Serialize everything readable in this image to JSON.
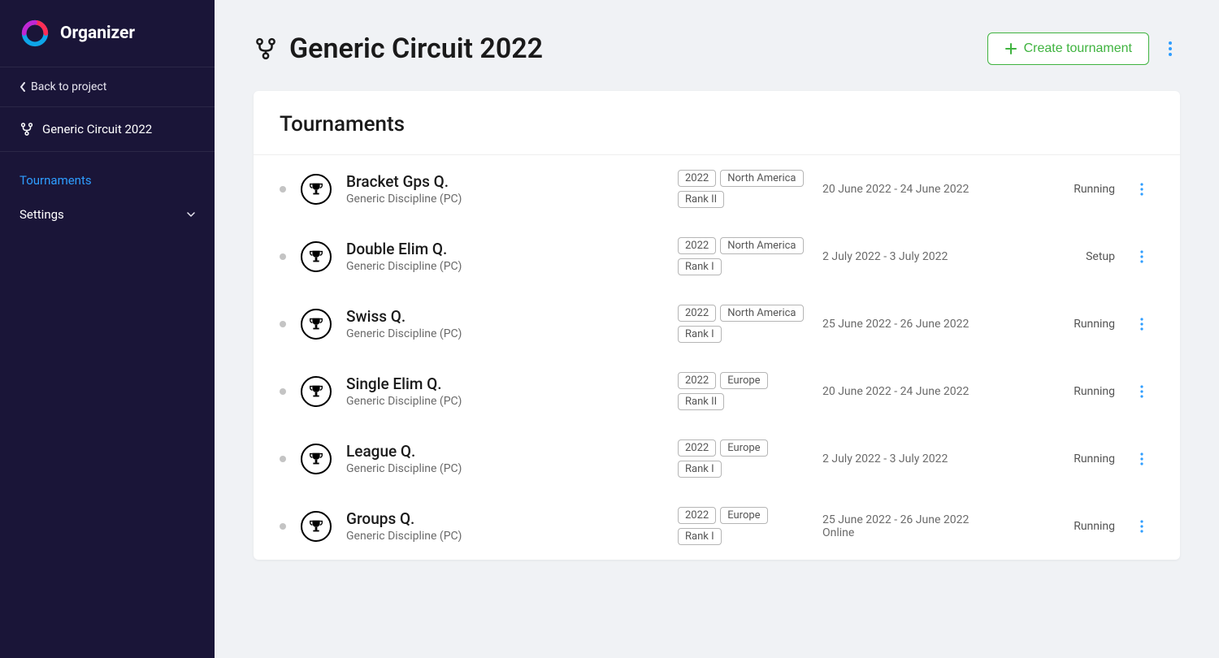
{
  "brand": {
    "name": "Organizer"
  },
  "sidebar": {
    "back_label": "Back to project",
    "circuit_label": "Generic Circuit 2022",
    "nav": {
      "tournaments": "Tournaments",
      "settings": "Settings"
    }
  },
  "header": {
    "title": "Generic Circuit 2022",
    "create_btn": "Create tournament"
  },
  "card": {
    "title": "Tournaments"
  },
  "tournaments": [
    {
      "name": "Bracket Gps Q.",
      "discipline": "Generic Discipline (PC)",
      "tags": [
        "2022",
        "North America",
        "Rank II"
      ],
      "dates": "20 June 2022 - 24 June 2022",
      "extra": "",
      "status": "Running"
    },
    {
      "name": "Double Elim Q.",
      "discipline": "Generic Discipline (PC)",
      "tags": [
        "2022",
        "North America",
        "Rank I"
      ],
      "dates": "2 July 2022 - 3 July 2022",
      "extra": "",
      "status": "Setup"
    },
    {
      "name": "Swiss Q.",
      "discipline": "Generic Discipline (PC)",
      "tags": [
        "2022",
        "North America",
        "Rank I"
      ],
      "dates": "25 June 2022 - 26 June 2022",
      "extra": "",
      "status": "Running"
    },
    {
      "name": "Single Elim Q.",
      "discipline": "Generic Discipline (PC)",
      "tags": [
        "2022",
        "Europe",
        "Rank II"
      ],
      "dates": "20 June 2022 - 24 June 2022",
      "extra": "",
      "status": "Running"
    },
    {
      "name": "League Q.",
      "discipline": "Generic Discipline (PC)",
      "tags": [
        "2022",
        "Europe",
        "Rank I"
      ],
      "dates": "2 July 2022 - 3 July 2022",
      "extra": "",
      "status": "Running"
    },
    {
      "name": "Groups Q.",
      "discipline": "Generic Discipline (PC)",
      "tags": [
        "2022",
        "Europe",
        "Rank I"
      ],
      "dates": "25 June 2022 - 26 June 2022",
      "extra": "Online",
      "status": "Running"
    }
  ]
}
